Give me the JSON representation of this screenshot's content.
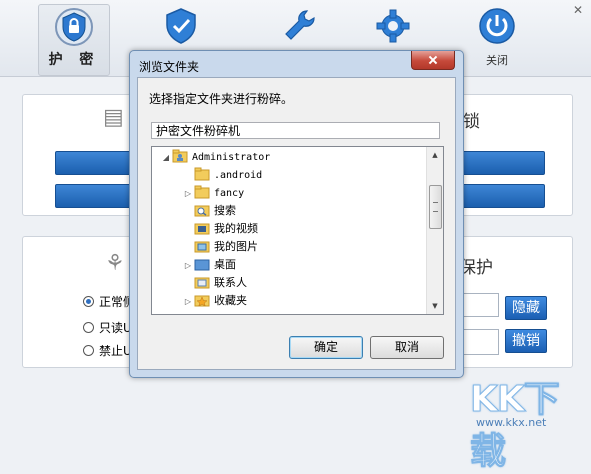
{
  "nav": {
    "items": [
      {
        "label": "护 密",
        "icon": "lock-shield-icon"
      },
      {
        "label": "",
        "icon": "shield-icon"
      },
      {
        "label": "",
        "icon": "wrench-icon"
      },
      {
        "label": "",
        "icon": "gear-icon"
      },
      {
        "label": "关闭",
        "icon": "power-icon"
      }
    ],
    "window_close": "✕"
  },
  "background": {
    "panel1_title_fragment": "锁",
    "panel2_title_fragment": "保护",
    "radios": [
      {
        "label": "正常侧",
        "checked": true
      },
      {
        "label": "只读U",
        "checked": false
      },
      {
        "label": "禁止U",
        "checked": false
      }
    ],
    "hide_button": "隐藏",
    "undo_button": "撤销"
  },
  "dialog": {
    "title": "浏览文件夹",
    "prompt": "选择指定文件夹进行粉碎。",
    "selected_path": "护密文件粉碎机",
    "tree": [
      {
        "label": "Administrator",
        "level": 0,
        "expander": "open",
        "icon": "user-folder-icon"
      },
      {
        "label": ".android",
        "level": 1,
        "expander": "none",
        "icon": "folder-icon"
      },
      {
        "label": "fancy",
        "level": 1,
        "expander": "closed",
        "icon": "folder-icon"
      },
      {
        "label": "搜索",
        "level": 1,
        "expander": "none",
        "icon": "search-folder-icon"
      },
      {
        "label": "我的视频",
        "level": 1,
        "expander": "none",
        "icon": "video-folder-icon"
      },
      {
        "label": "我的图片",
        "level": 1,
        "expander": "none",
        "icon": "picture-folder-icon"
      },
      {
        "label": "桌面",
        "level": 1,
        "expander": "closed",
        "icon": "desktop-folder-icon"
      },
      {
        "label": "联系人",
        "level": 1,
        "expander": "none",
        "icon": "contacts-folder-icon"
      },
      {
        "label": "收藏夹",
        "level": 1,
        "expander": "closed",
        "icon": "favorites-folder-icon"
      }
    ],
    "ok_button": "确定",
    "cancel_button": "取消"
  },
  "watermark": {
    "text": "KK下载",
    "url": "www.kkx.net"
  },
  "colors": {
    "accent_blue": "#1b5fae",
    "dialog_frame": "#c9d9ec",
    "close_red": "#c6493a"
  }
}
